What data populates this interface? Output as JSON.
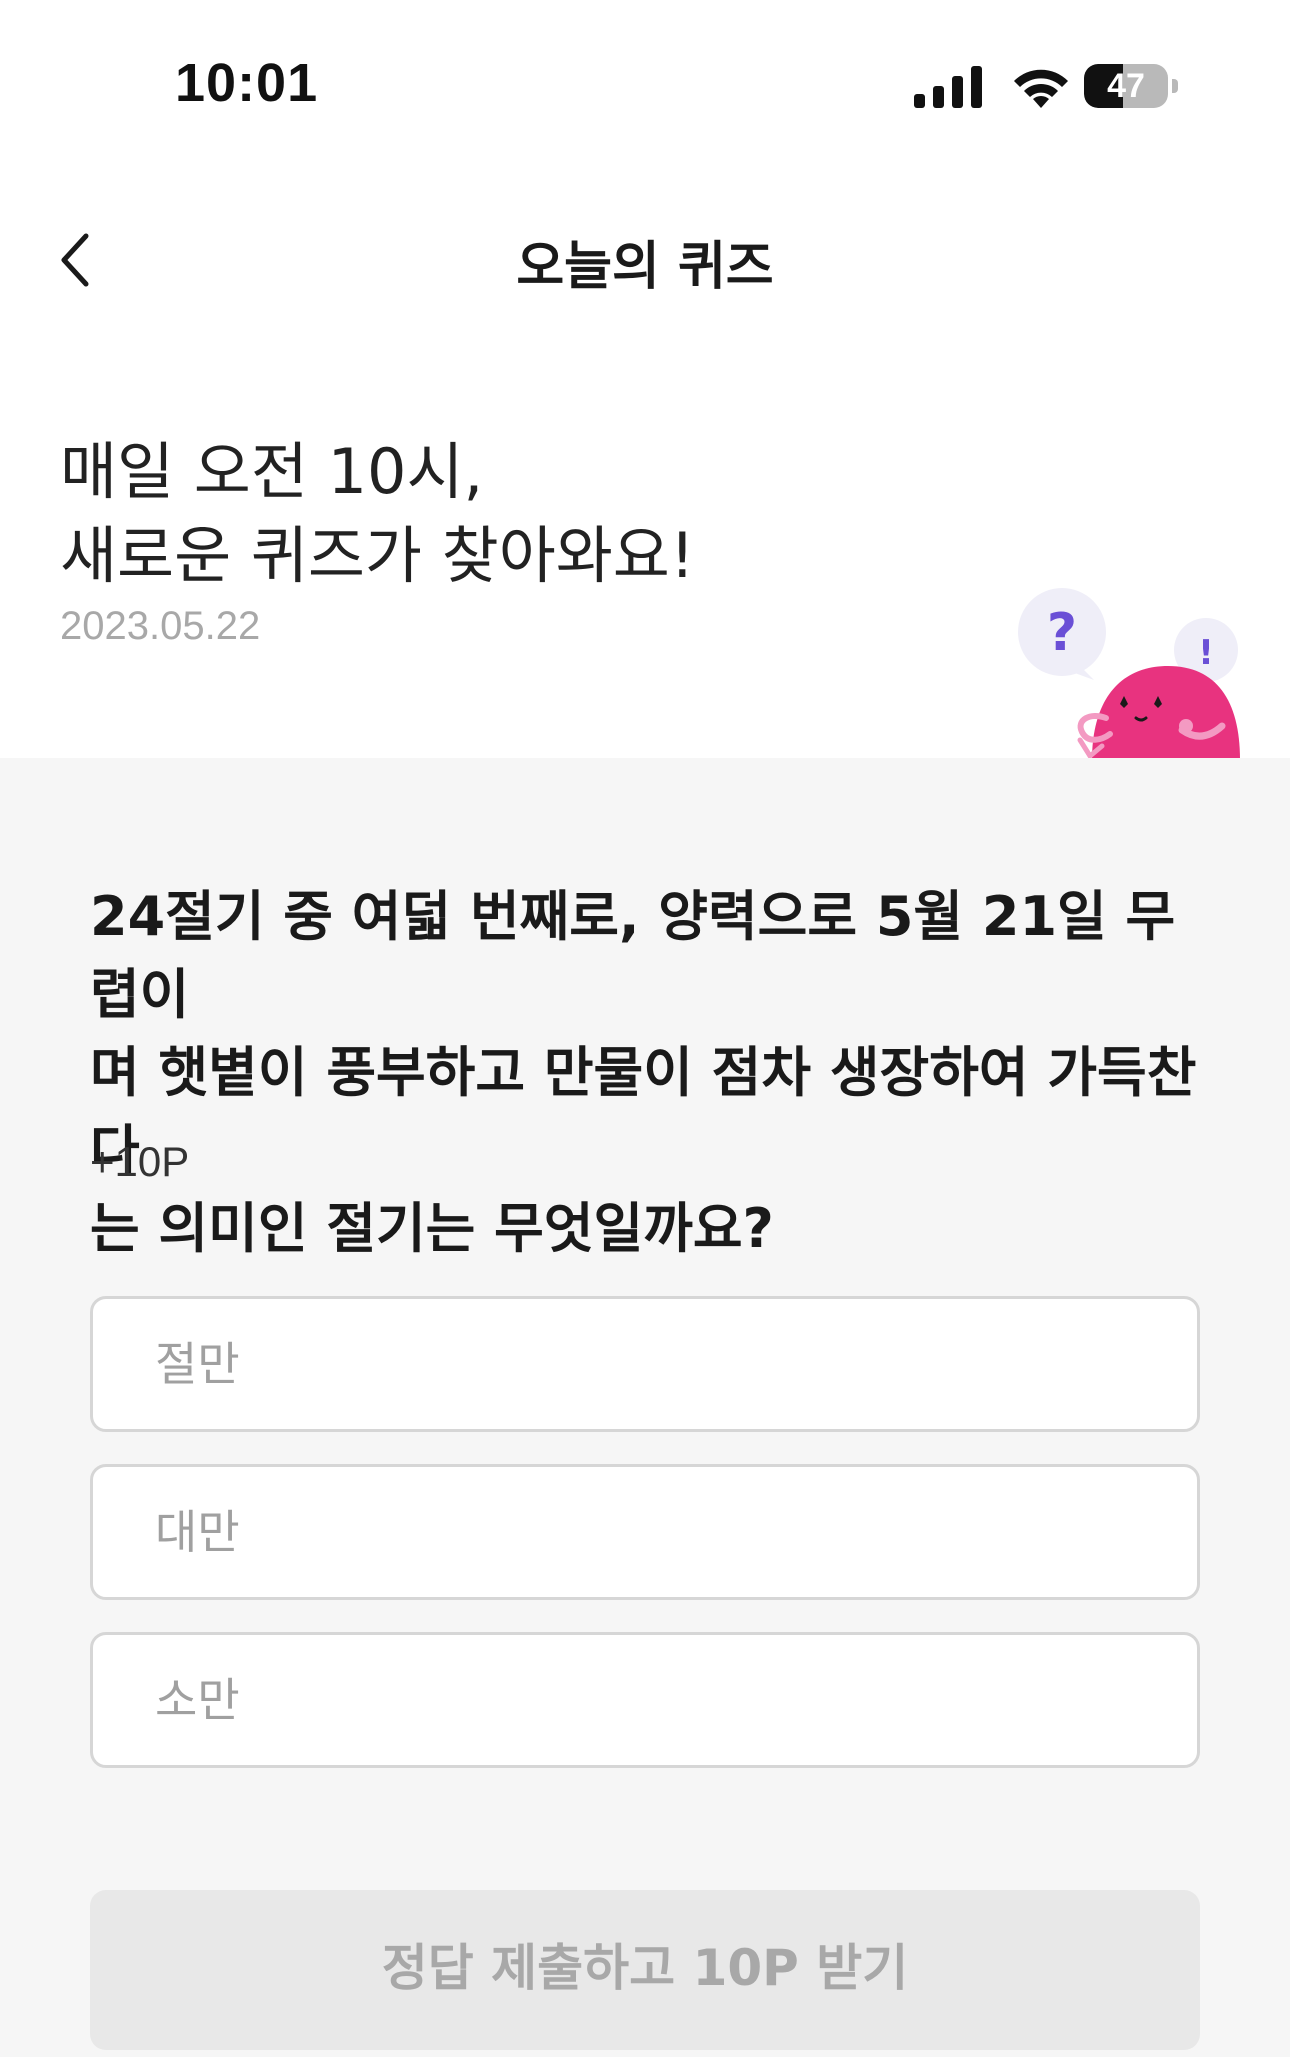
{
  "status_bar": {
    "time": "10:01",
    "battery_level": "47",
    "battery_fraction": 0.47
  },
  "nav": {
    "title": "오늘의 퀴즈",
    "back_icon": "chevron-left-icon"
  },
  "intro": {
    "line1": "매일 오전 10시,",
    "line2": "새로운 퀴즈가 찾아와요!",
    "date": "2023.05.22"
  },
  "mascot": {
    "question_mark": "?",
    "exclamation_mark": "!"
  },
  "quiz": {
    "question": "24절기 중 여덟 번째로, 양력으로 5월 21일 무렵이\n며 햇볕이 풍부하고 만물이 점차 생장하여 가득찬다\n는 의미인 절기는 무엇일까요?",
    "points": "+10P",
    "options": [
      {
        "label": "절만"
      },
      {
        "label": "대만"
      },
      {
        "label": "소만"
      }
    ],
    "submit_label": "정답 제출하고 10P 받기"
  },
  "colors": {
    "quiz_background": "#f6f6f6",
    "mascot_pink": "#e8337f",
    "mascot_accent_purple": "#6a4fd6",
    "submit_disabled_bg": "#e8e8e8"
  }
}
